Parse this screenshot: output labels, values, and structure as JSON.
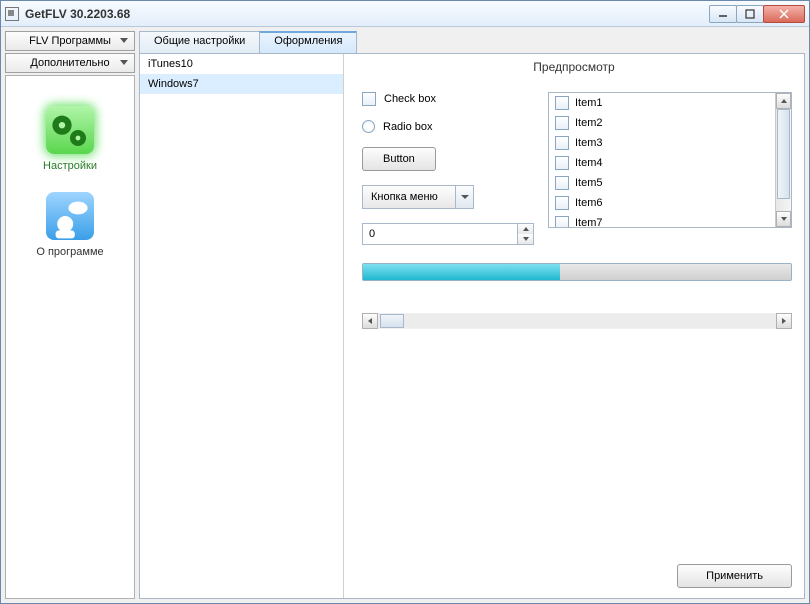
{
  "titlebar": {
    "title": "GetFLV 30.2203.68"
  },
  "leftmenus": {
    "flv": "FLV Программы",
    "extra": "Дополнительно"
  },
  "sidebar": {
    "items": [
      {
        "label": "Настройки"
      },
      {
        "label": "О программе"
      }
    ]
  },
  "tabs": {
    "general": "Общие настройки",
    "themes": "Оформления"
  },
  "themes": [
    "iTunes10",
    "Windows7"
  ],
  "preview": {
    "header": "Предпросмотр",
    "checkbox": "Check box",
    "radiobox": "Radio box",
    "button": "Button",
    "menu": "Кнопка меню",
    "spinner": "0",
    "list": [
      "Item1",
      "Item2",
      "Item3",
      "Item4",
      "Item5",
      "Item6",
      "Item7"
    ]
  },
  "footer": {
    "apply": "Применить"
  }
}
